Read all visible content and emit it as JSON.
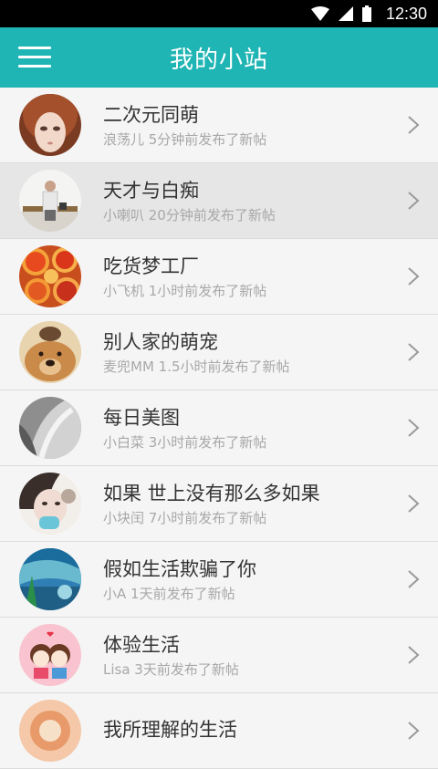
{
  "status_bar": {
    "time": "12:30"
  },
  "header": {
    "title": "我的小站"
  },
  "items": [
    {
      "title": "二次元同萌",
      "subtitle": "浪荡儿 5分钟前发布了新帖"
    },
    {
      "title": "天才与白痴",
      "subtitle": "小喇叭 20分钟前发布了新帖"
    },
    {
      "title": "吃货梦工厂",
      "subtitle": "小飞机 1小时前发布了新帖"
    },
    {
      "title": "别人家的萌宠",
      "subtitle": "麦兜MM 1.5小时前发布了新帖"
    },
    {
      "title": "每日美图",
      "subtitle": "小白菜 3小时前发布了新帖"
    },
    {
      "title": "如果 世上没有那么多如果",
      "subtitle": "小块闰 7小时前发布了新帖"
    },
    {
      "title": "假如生活欺骗了你",
      "subtitle": "小A 1天前发布了新帖"
    },
    {
      "title": "体验生活",
      "subtitle": "Lisa 3天前发布了新帖"
    },
    {
      "title": "我所理解的生活",
      "subtitle": ""
    }
  ],
  "colors": {
    "accent": "#1fb5b4",
    "selected_row": "#e6e6e6"
  }
}
